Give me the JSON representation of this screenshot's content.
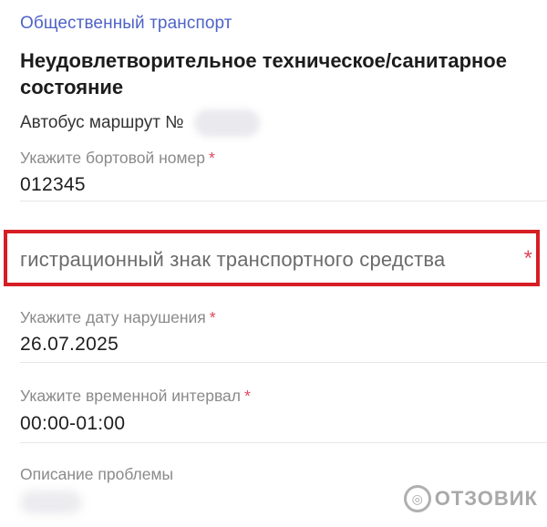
{
  "category": "Общественный транспорт",
  "issue_title": "Неудовлетворительное техническое/санитарное состояние",
  "route_label": "Автобус маршрут №",
  "fields": {
    "board_number": {
      "label": "Укажите бортовой номер",
      "required_mark": "*",
      "value": "012345"
    },
    "registration": {
      "label": "гистрационный знак транспортного средства",
      "required_mark": "*"
    },
    "date": {
      "label": "Укажите дату нарушения",
      "required_mark": "*",
      "value": "26.07.2025"
    },
    "interval": {
      "label": "Укажите временной интервал",
      "required_mark": "*",
      "value": "00:00-01:00"
    },
    "description": {
      "label": "Описание проблемы"
    }
  },
  "highlight_color": "#d61e24",
  "watermark": {
    "text": "ОТЗОВИК",
    "icon": "otzovik-logo-icon"
  }
}
